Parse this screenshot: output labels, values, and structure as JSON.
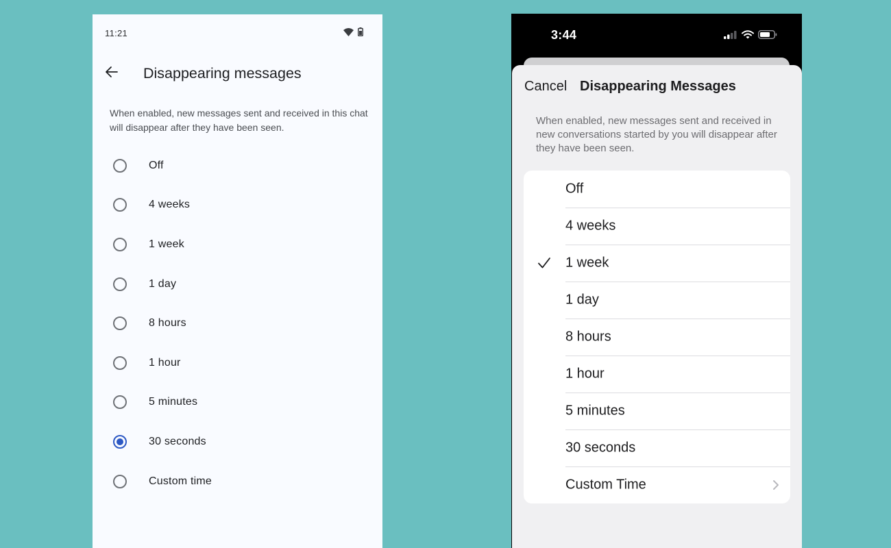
{
  "android": {
    "status_time": "11:21",
    "title": "Disappearing messages",
    "description": "When enabled, new messages sent and received in this chat will disappear after they have been seen.",
    "options": [
      {
        "label": "Off",
        "selected": false
      },
      {
        "label": "4 weeks",
        "selected": false
      },
      {
        "label": "1 week",
        "selected": false
      },
      {
        "label": "1 day",
        "selected": false
      },
      {
        "label": "8 hours",
        "selected": false
      },
      {
        "label": "1 hour",
        "selected": false
      },
      {
        "label": "5 minutes",
        "selected": false
      },
      {
        "label": "30 seconds",
        "selected": true
      },
      {
        "label": "Custom time",
        "selected": false
      }
    ],
    "accent_color": "#2c58c4"
  },
  "ios": {
    "status_time": "3:44",
    "cancel_label": "Cancel",
    "title": "Disappearing Messages",
    "description": "When enabled, new messages sent and received in new conversations started by you will disappear after they have been seen.",
    "options": [
      {
        "label": "Off",
        "selected": false
      },
      {
        "label": "4 weeks",
        "selected": false
      },
      {
        "label": "1 week",
        "selected": true
      },
      {
        "label": "1 day",
        "selected": false
      },
      {
        "label": "8 hours",
        "selected": false
      },
      {
        "label": "1 hour",
        "selected": false
      },
      {
        "label": "5 minutes",
        "selected": false
      },
      {
        "label": "30 seconds",
        "selected": false
      },
      {
        "label": "Custom Time",
        "selected": false
      }
    ]
  },
  "background_color": "#6abfc0"
}
